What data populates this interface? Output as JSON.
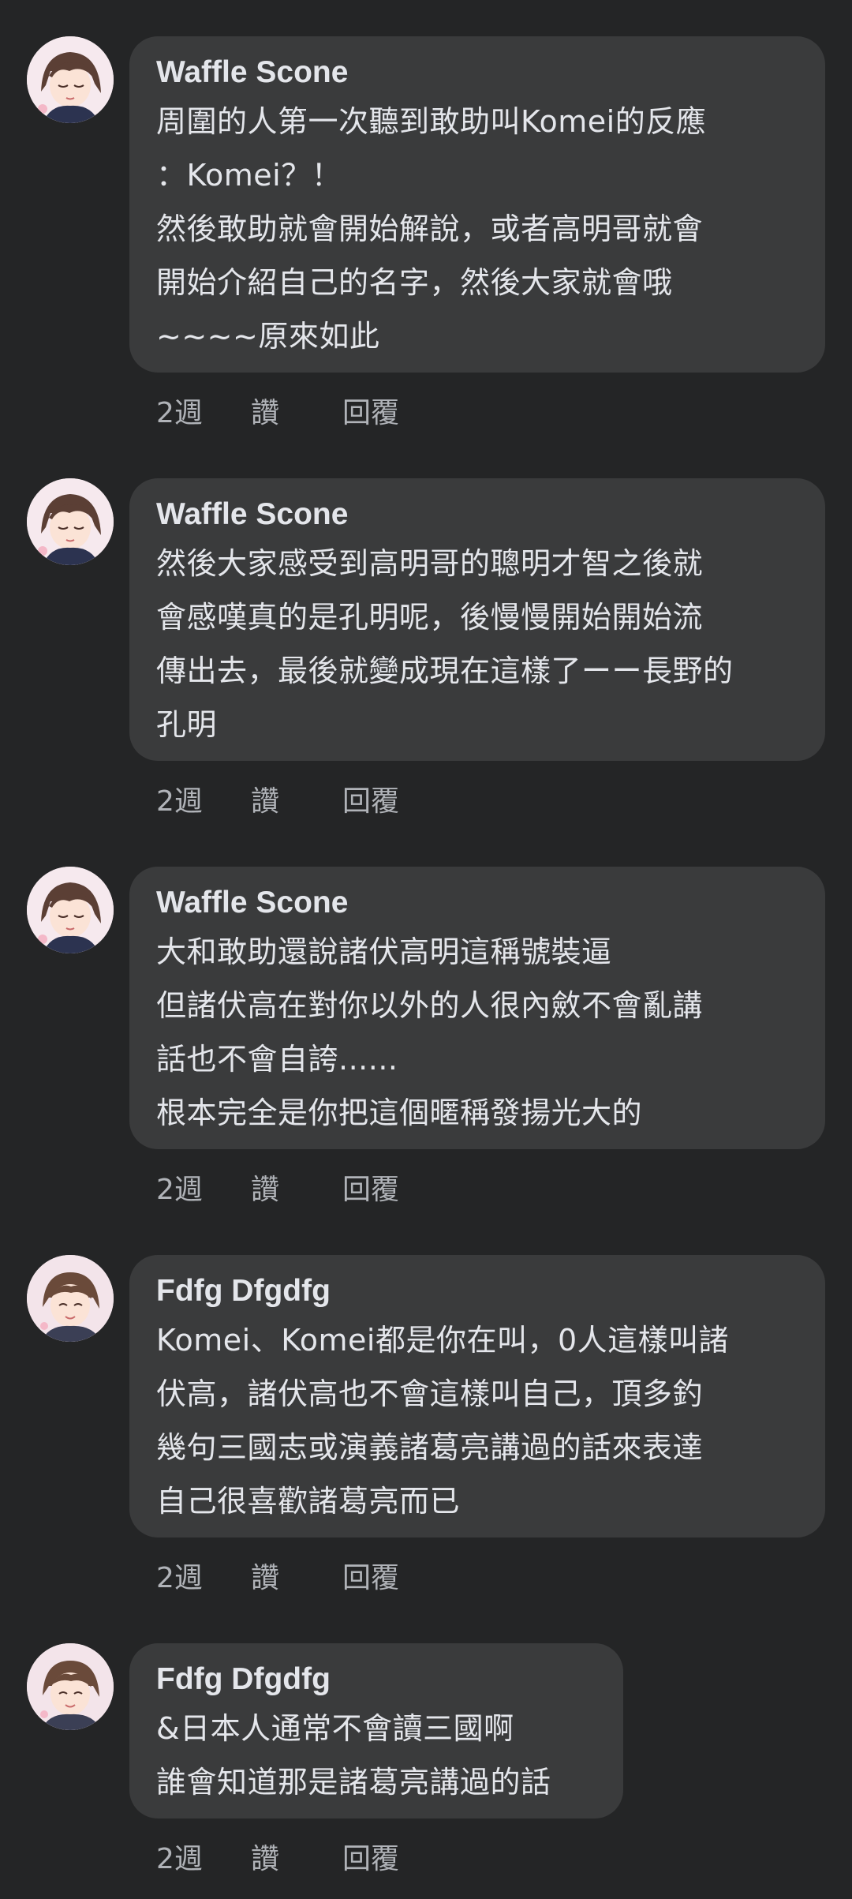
{
  "comments": [
    {
      "author": "Waffle Scone",
      "text": "周圍的人第一次聽到敢助叫Komei的反應\n：Komei？！\n然後敢助就會開始解說，或者高明哥就會\n開始介紹自己的名字，然後大家就會哦\n~~~~原來如此",
      "time": "2週",
      "like": "讚",
      "reply": "回覆"
    },
    {
      "author": "Waffle Scone",
      "text": "然後大家感受到高明哥的聰明才智之後就\n會感嘆真的是孔明呢，後慢慢開始開始流\n傳出去，最後就變成現在這樣了ーー長野的\n孔明",
      "time": "2週",
      "like": "讚",
      "reply": "回覆"
    },
    {
      "author": "Waffle Scone",
      "text": "大和敢助還說諸伏高明這稱號裝逼\n但諸伏高在對你以外的人很內斂不會亂講\n話也不會自誇......\n根本完全是你把這個暱稱發揚光大的",
      "time": "2週",
      "like": "讚",
      "reply": "回覆"
    },
    {
      "author": "Fdfg Dfgdfg",
      "text": "Komei、Komei都是你在叫，0人這樣叫諸\n伏高，諸伏高也不會這樣叫自己，頂多釣\n幾句三國志或演義諸葛亮講過的話來表達\n自己很喜歡諸葛亮而已",
      "time": "2週",
      "like": "讚",
      "reply": "回覆"
    },
    {
      "author": "Fdfg Dfgdfg",
      "text": "&日本人通常不會讀三國啊\n誰會知道那是諸葛亮講過的話",
      "time": "2週",
      "like": "讚",
      "reply": "回覆"
    }
  ]
}
